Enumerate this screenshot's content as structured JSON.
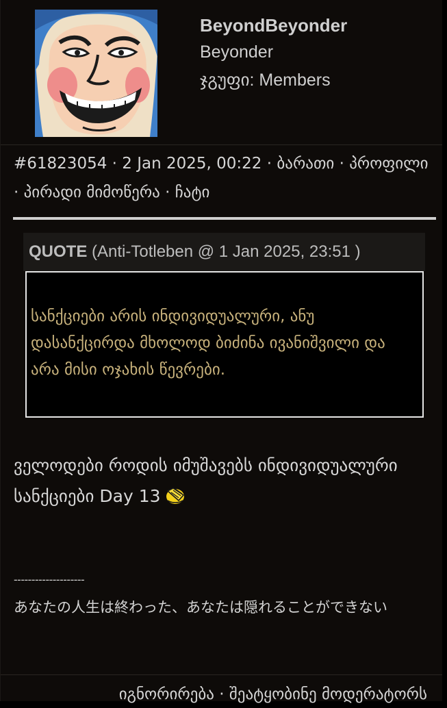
{
  "post": {
    "user": {
      "username": "BeyondBeyonder",
      "title": "Beyonder",
      "group_label": "ჯგუფი:",
      "group_value": "Members"
    },
    "meta": {
      "post_id": "#61823054",
      "separator": "·",
      "date": "2 Jan 2025, 00:22",
      "card_link": "ბარათი",
      "profile_link": "პროფილი",
      "pm_link": "პირადი მიმოწერა",
      "chat_link": "ჩატი"
    },
    "quote": {
      "label": "QUOTE",
      "source": "(Anti-Totleben @ 1 Jan 2025, 23:51 )",
      "text": "სანქციები არის ინდივიდუალური, ანუ დასანქცირდა მხოლოდ ბიძინა ივანიშვილი და არა მისი ოჯახის წევრები."
    },
    "message": {
      "text": "ველოდები როდის იმუშავებს ინდივიდუალური სანქციები Day 13",
      "emoji": "facepalm-emoji"
    },
    "signature": {
      "rule": "--------------------",
      "text": "あなたの人生は終わった、あなたは隠れることができない"
    },
    "footer": {
      "ignore_link": "იგნორირება",
      "separator": "·",
      "report_link": "შეატყობინე მოდერატორს"
    }
  },
  "colors": {
    "background": "#0e0b09",
    "quote_text": "#c8b27c",
    "text": "#d8d8d8",
    "quote_header_bg": "#1b1917"
  }
}
